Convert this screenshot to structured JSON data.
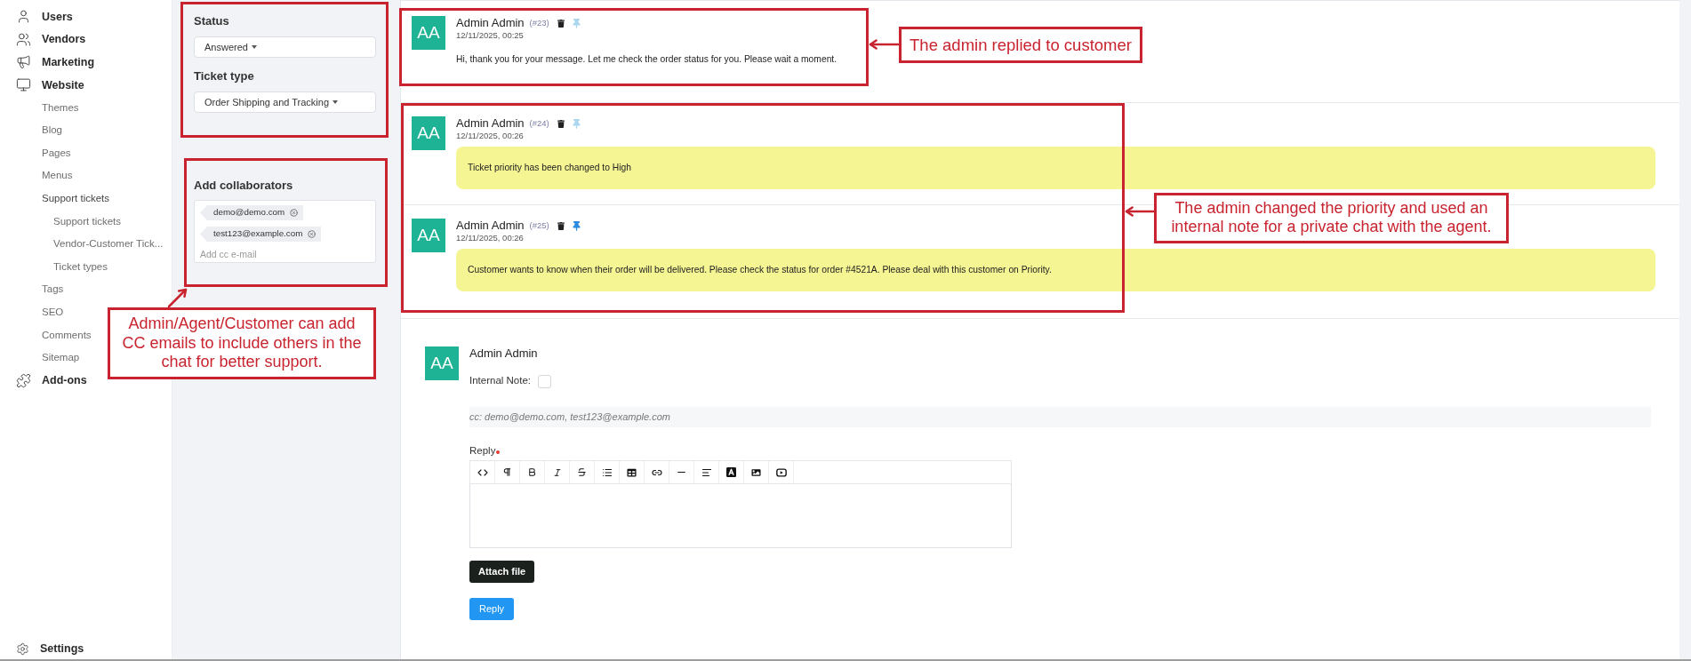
{
  "sidebar": {
    "items": [
      {
        "label": "Users"
      },
      {
        "label": "Vendors"
      },
      {
        "label": "Marketing"
      },
      {
        "label": "Website",
        "children": [
          {
            "label": "Themes"
          },
          {
            "label": "Blog"
          },
          {
            "label": "Pages"
          },
          {
            "label": "Menus"
          },
          {
            "label": "Support tickets",
            "children": [
              {
                "label": "Support tickets"
              },
              {
                "label": "Vendor-Customer Tick..."
              },
              {
                "label": "Ticket types"
              }
            ]
          },
          {
            "label": "Tags"
          },
          {
            "label": "SEO"
          },
          {
            "label": "Comments"
          },
          {
            "label": "Sitemap"
          }
        ]
      },
      {
        "label": "Add-ons"
      }
    ],
    "footer": {
      "label": "Settings"
    }
  },
  "ticket_settings": {
    "status": {
      "label": "Status",
      "value": "Answered"
    },
    "ticket_type": {
      "label": "Ticket type",
      "value": "Order Shipping and Tracking"
    }
  },
  "collaborators": {
    "label": "Add collaborators",
    "emails": [
      "demo@demo.com",
      "test123@example.com"
    ],
    "placeholder": "Add cc e-mail"
  },
  "messages": [
    {
      "initials": "AA",
      "author": "Admin Admin",
      "number": "(#23)",
      "time": "12/11/2025, 00:25",
      "text": "Hi, thank you for your message. Let me check the order status for you. Please wait a moment.",
      "internal": false,
      "pinned": false
    },
    {
      "initials": "AA",
      "author": "Admin Admin",
      "number": "(#24)",
      "time": "12/11/2025, 00:26",
      "text": "Ticket priority has been changed to High",
      "internal": true,
      "pinned": false
    },
    {
      "initials": "AA",
      "author": "Admin Admin",
      "number": "(#25)",
      "time": "12/11/2025, 00:26",
      "text": "Customer wants to know when their order will be delivered. Please check the status for order #4521A. Please deal with this customer on Priority.",
      "internal": true,
      "pinned": true
    }
  ],
  "reply_form": {
    "initials": "AA",
    "author": "Admin Admin",
    "internal_note": {
      "label": "Internal Note:",
      "checked": false
    },
    "cc": "cc: demo@demo.com, test123@example.com",
    "editor": {
      "label": "Reply",
      "required": true
    },
    "attach_button": "Attach file",
    "submit_button": "Reply"
  },
  "annotations": [
    {
      "lines": [
        "The admin replied to customer"
      ]
    },
    {
      "lines": [
        "The admin changed the priority and used an",
        "internal note for a private chat with the agent."
      ]
    },
    {
      "lines": [
        "Admin/Agent/Customer can add",
        "CC emails to include others in the",
        "chat for better support."
      ]
    }
  ]
}
